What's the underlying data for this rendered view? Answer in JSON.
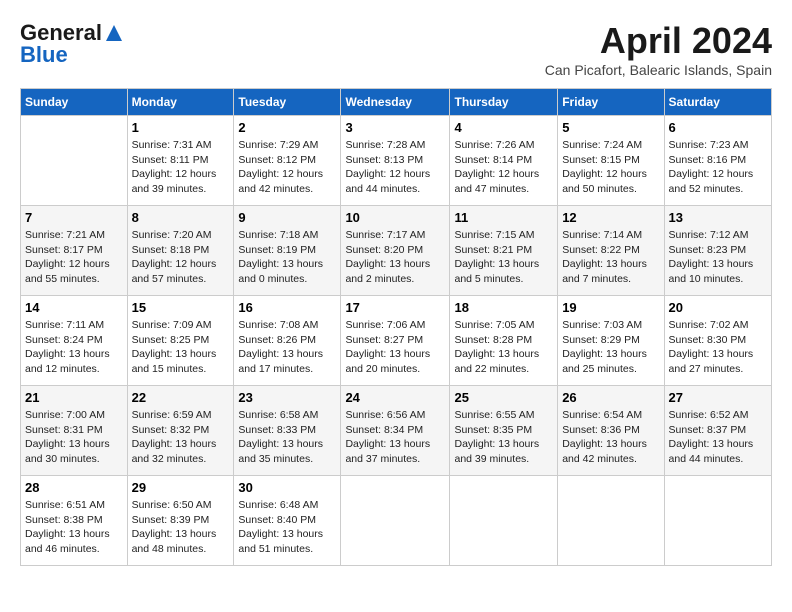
{
  "header": {
    "logo_general": "General",
    "logo_blue": "Blue",
    "title": "April 2024",
    "location": "Can Picafort, Balearic Islands, Spain"
  },
  "weekdays": [
    "Sunday",
    "Monday",
    "Tuesday",
    "Wednesday",
    "Thursday",
    "Friday",
    "Saturday"
  ],
  "weeks": [
    [
      {
        "day": "",
        "sunrise": "",
        "sunset": "",
        "daylight": ""
      },
      {
        "day": "1",
        "sunrise": "Sunrise: 7:31 AM",
        "sunset": "Sunset: 8:11 PM",
        "daylight": "Daylight: 12 hours and 39 minutes."
      },
      {
        "day": "2",
        "sunrise": "Sunrise: 7:29 AM",
        "sunset": "Sunset: 8:12 PM",
        "daylight": "Daylight: 12 hours and 42 minutes."
      },
      {
        "day": "3",
        "sunrise": "Sunrise: 7:28 AM",
        "sunset": "Sunset: 8:13 PM",
        "daylight": "Daylight: 12 hours and 44 minutes."
      },
      {
        "day": "4",
        "sunrise": "Sunrise: 7:26 AM",
        "sunset": "Sunset: 8:14 PM",
        "daylight": "Daylight: 12 hours and 47 minutes."
      },
      {
        "day": "5",
        "sunrise": "Sunrise: 7:24 AM",
        "sunset": "Sunset: 8:15 PM",
        "daylight": "Daylight: 12 hours and 50 minutes."
      },
      {
        "day": "6",
        "sunrise": "Sunrise: 7:23 AM",
        "sunset": "Sunset: 8:16 PM",
        "daylight": "Daylight: 12 hours and 52 minutes."
      }
    ],
    [
      {
        "day": "7",
        "sunrise": "Sunrise: 7:21 AM",
        "sunset": "Sunset: 8:17 PM",
        "daylight": "Daylight: 12 hours and 55 minutes."
      },
      {
        "day": "8",
        "sunrise": "Sunrise: 7:20 AM",
        "sunset": "Sunset: 8:18 PM",
        "daylight": "Daylight: 12 hours and 57 minutes."
      },
      {
        "day": "9",
        "sunrise": "Sunrise: 7:18 AM",
        "sunset": "Sunset: 8:19 PM",
        "daylight": "Daylight: 13 hours and 0 minutes."
      },
      {
        "day": "10",
        "sunrise": "Sunrise: 7:17 AM",
        "sunset": "Sunset: 8:20 PM",
        "daylight": "Daylight: 13 hours and 2 minutes."
      },
      {
        "day": "11",
        "sunrise": "Sunrise: 7:15 AM",
        "sunset": "Sunset: 8:21 PM",
        "daylight": "Daylight: 13 hours and 5 minutes."
      },
      {
        "day": "12",
        "sunrise": "Sunrise: 7:14 AM",
        "sunset": "Sunset: 8:22 PM",
        "daylight": "Daylight: 13 hours and 7 minutes."
      },
      {
        "day": "13",
        "sunrise": "Sunrise: 7:12 AM",
        "sunset": "Sunset: 8:23 PM",
        "daylight": "Daylight: 13 hours and 10 minutes."
      }
    ],
    [
      {
        "day": "14",
        "sunrise": "Sunrise: 7:11 AM",
        "sunset": "Sunset: 8:24 PM",
        "daylight": "Daylight: 13 hours and 12 minutes."
      },
      {
        "day": "15",
        "sunrise": "Sunrise: 7:09 AM",
        "sunset": "Sunset: 8:25 PM",
        "daylight": "Daylight: 13 hours and 15 minutes."
      },
      {
        "day": "16",
        "sunrise": "Sunrise: 7:08 AM",
        "sunset": "Sunset: 8:26 PM",
        "daylight": "Daylight: 13 hours and 17 minutes."
      },
      {
        "day": "17",
        "sunrise": "Sunrise: 7:06 AM",
        "sunset": "Sunset: 8:27 PM",
        "daylight": "Daylight: 13 hours and 20 minutes."
      },
      {
        "day": "18",
        "sunrise": "Sunrise: 7:05 AM",
        "sunset": "Sunset: 8:28 PM",
        "daylight": "Daylight: 13 hours and 22 minutes."
      },
      {
        "day": "19",
        "sunrise": "Sunrise: 7:03 AM",
        "sunset": "Sunset: 8:29 PM",
        "daylight": "Daylight: 13 hours and 25 minutes."
      },
      {
        "day": "20",
        "sunrise": "Sunrise: 7:02 AM",
        "sunset": "Sunset: 8:30 PM",
        "daylight": "Daylight: 13 hours and 27 minutes."
      }
    ],
    [
      {
        "day": "21",
        "sunrise": "Sunrise: 7:00 AM",
        "sunset": "Sunset: 8:31 PM",
        "daylight": "Daylight: 13 hours and 30 minutes."
      },
      {
        "day": "22",
        "sunrise": "Sunrise: 6:59 AM",
        "sunset": "Sunset: 8:32 PM",
        "daylight": "Daylight: 13 hours and 32 minutes."
      },
      {
        "day": "23",
        "sunrise": "Sunrise: 6:58 AM",
        "sunset": "Sunset: 8:33 PM",
        "daylight": "Daylight: 13 hours and 35 minutes."
      },
      {
        "day": "24",
        "sunrise": "Sunrise: 6:56 AM",
        "sunset": "Sunset: 8:34 PM",
        "daylight": "Daylight: 13 hours and 37 minutes."
      },
      {
        "day": "25",
        "sunrise": "Sunrise: 6:55 AM",
        "sunset": "Sunset: 8:35 PM",
        "daylight": "Daylight: 13 hours and 39 minutes."
      },
      {
        "day": "26",
        "sunrise": "Sunrise: 6:54 AM",
        "sunset": "Sunset: 8:36 PM",
        "daylight": "Daylight: 13 hours and 42 minutes."
      },
      {
        "day": "27",
        "sunrise": "Sunrise: 6:52 AM",
        "sunset": "Sunset: 8:37 PM",
        "daylight": "Daylight: 13 hours and 44 minutes."
      }
    ],
    [
      {
        "day": "28",
        "sunrise": "Sunrise: 6:51 AM",
        "sunset": "Sunset: 8:38 PM",
        "daylight": "Daylight: 13 hours and 46 minutes."
      },
      {
        "day": "29",
        "sunrise": "Sunrise: 6:50 AM",
        "sunset": "Sunset: 8:39 PM",
        "daylight": "Daylight: 13 hours and 48 minutes."
      },
      {
        "day": "30",
        "sunrise": "Sunrise: 6:48 AM",
        "sunset": "Sunset: 8:40 PM",
        "daylight": "Daylight: 13 hours and 51 minutes."
      },
      {
        "day": "",
        "sunrise": "",
        "sunset": "",
        "daylight": ""
      },
      {
        "day": "",
        "sunrise": "",
        "sunset": "",
        "daylight": ""
      },
      {
        "day": "",
        "sunrise": "",
        "sunset": "",
        "daylight": ""
      },
      {
        "day": "",
        "sunrise": "",
        "sunset": "",
        "daylight": ""
      }
    ]
  ]
}
